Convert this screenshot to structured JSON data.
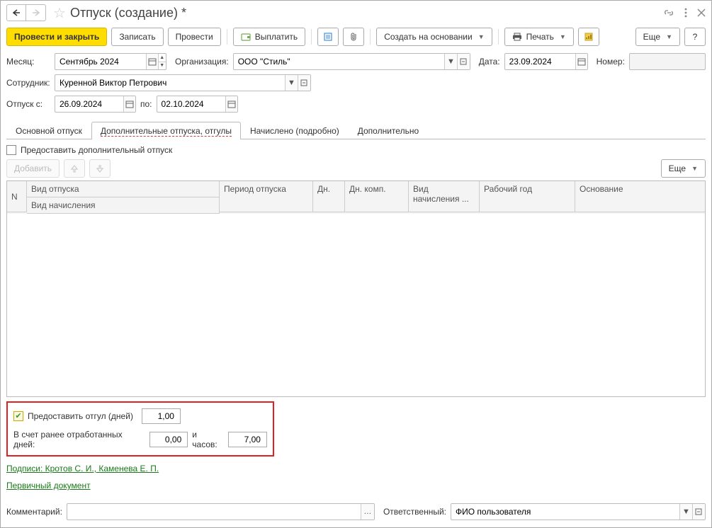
{
  "title": "Отпуск (создание) *",
  "toolbar": {
    "post_close": "Провести и закрыть",
    "save": "Записать",
    "post": "Провести",
    "pay": "Выплатить",
    "create_based": "Создать на основании",
    "print": "Печать",
    "more": "Еще",
    "help": "?"
  },
  "header": {
    "month_lbl": "Месяц:",
    "month_val": "Сентябрь 2024",
    "org_lbl": "Организация:",
    "org_val": "ООО \"Стиль\"",
    "date_lbl": "Дата:",
    "date_val": "23.09.2024",
    "number_lbl": "Номер:",
    "number_val": "",
    "employee_lbl": "Сотрудник:",
    "employee_val": "Куренной Виктор Петрович",
    "from_lbl": "Отпуск с:",
    "from_val": "26.09.2024",
    "to_lbl": "по:",
    "to_val": "02.10.2024"
  },
  "tabs": {
    "t1": "Основной отпуск",
    "t2": "Дополнительные отпуска, отгулы",
    "t3": "Начислено (подробно)",
    "t4": "Дополнительно"
  },
  "tabc": {
    "extra_leave_cb": "Предоставить дополнительный отпуск",
    "add": "Добавить",
    "more": "Еще"
  },
  "cols": {
    "n": "N",
    "type": "Вид отпуска",
    "accrual": "Вид начисления",
    "period": "Период отпуска",
    "days": "Дн.",
    "days_comp": "Дн. комп.",
    "accrual2": "Вид начисления ...",
    "work_year": "Рабочий год",
    "basis": "Основание"
  },
  "dayoff": {
    "give_lbl": "Предоставить отгул (дней)",
    "give_val": "1,00",
    "prev_days_lbl": "В счет ранее отработанных дней:",
    "prev_days_val": "0,00",
    "hours_lbl": "и часов:",
    "hours_val": "7,00"
  },
  "links": {
    "signatures": "Подписи: Кротов С. И., Каменева Е. П.",
    "primary_doc": "Первичный документ"
  },
  "bottom": {
    "comment_lbl": "Комментарий:",
    "comment_val": "",
    "responsible_lbl": "Ответственный:",
    "responsible_val": "ФИО пользователя"
  }
}
